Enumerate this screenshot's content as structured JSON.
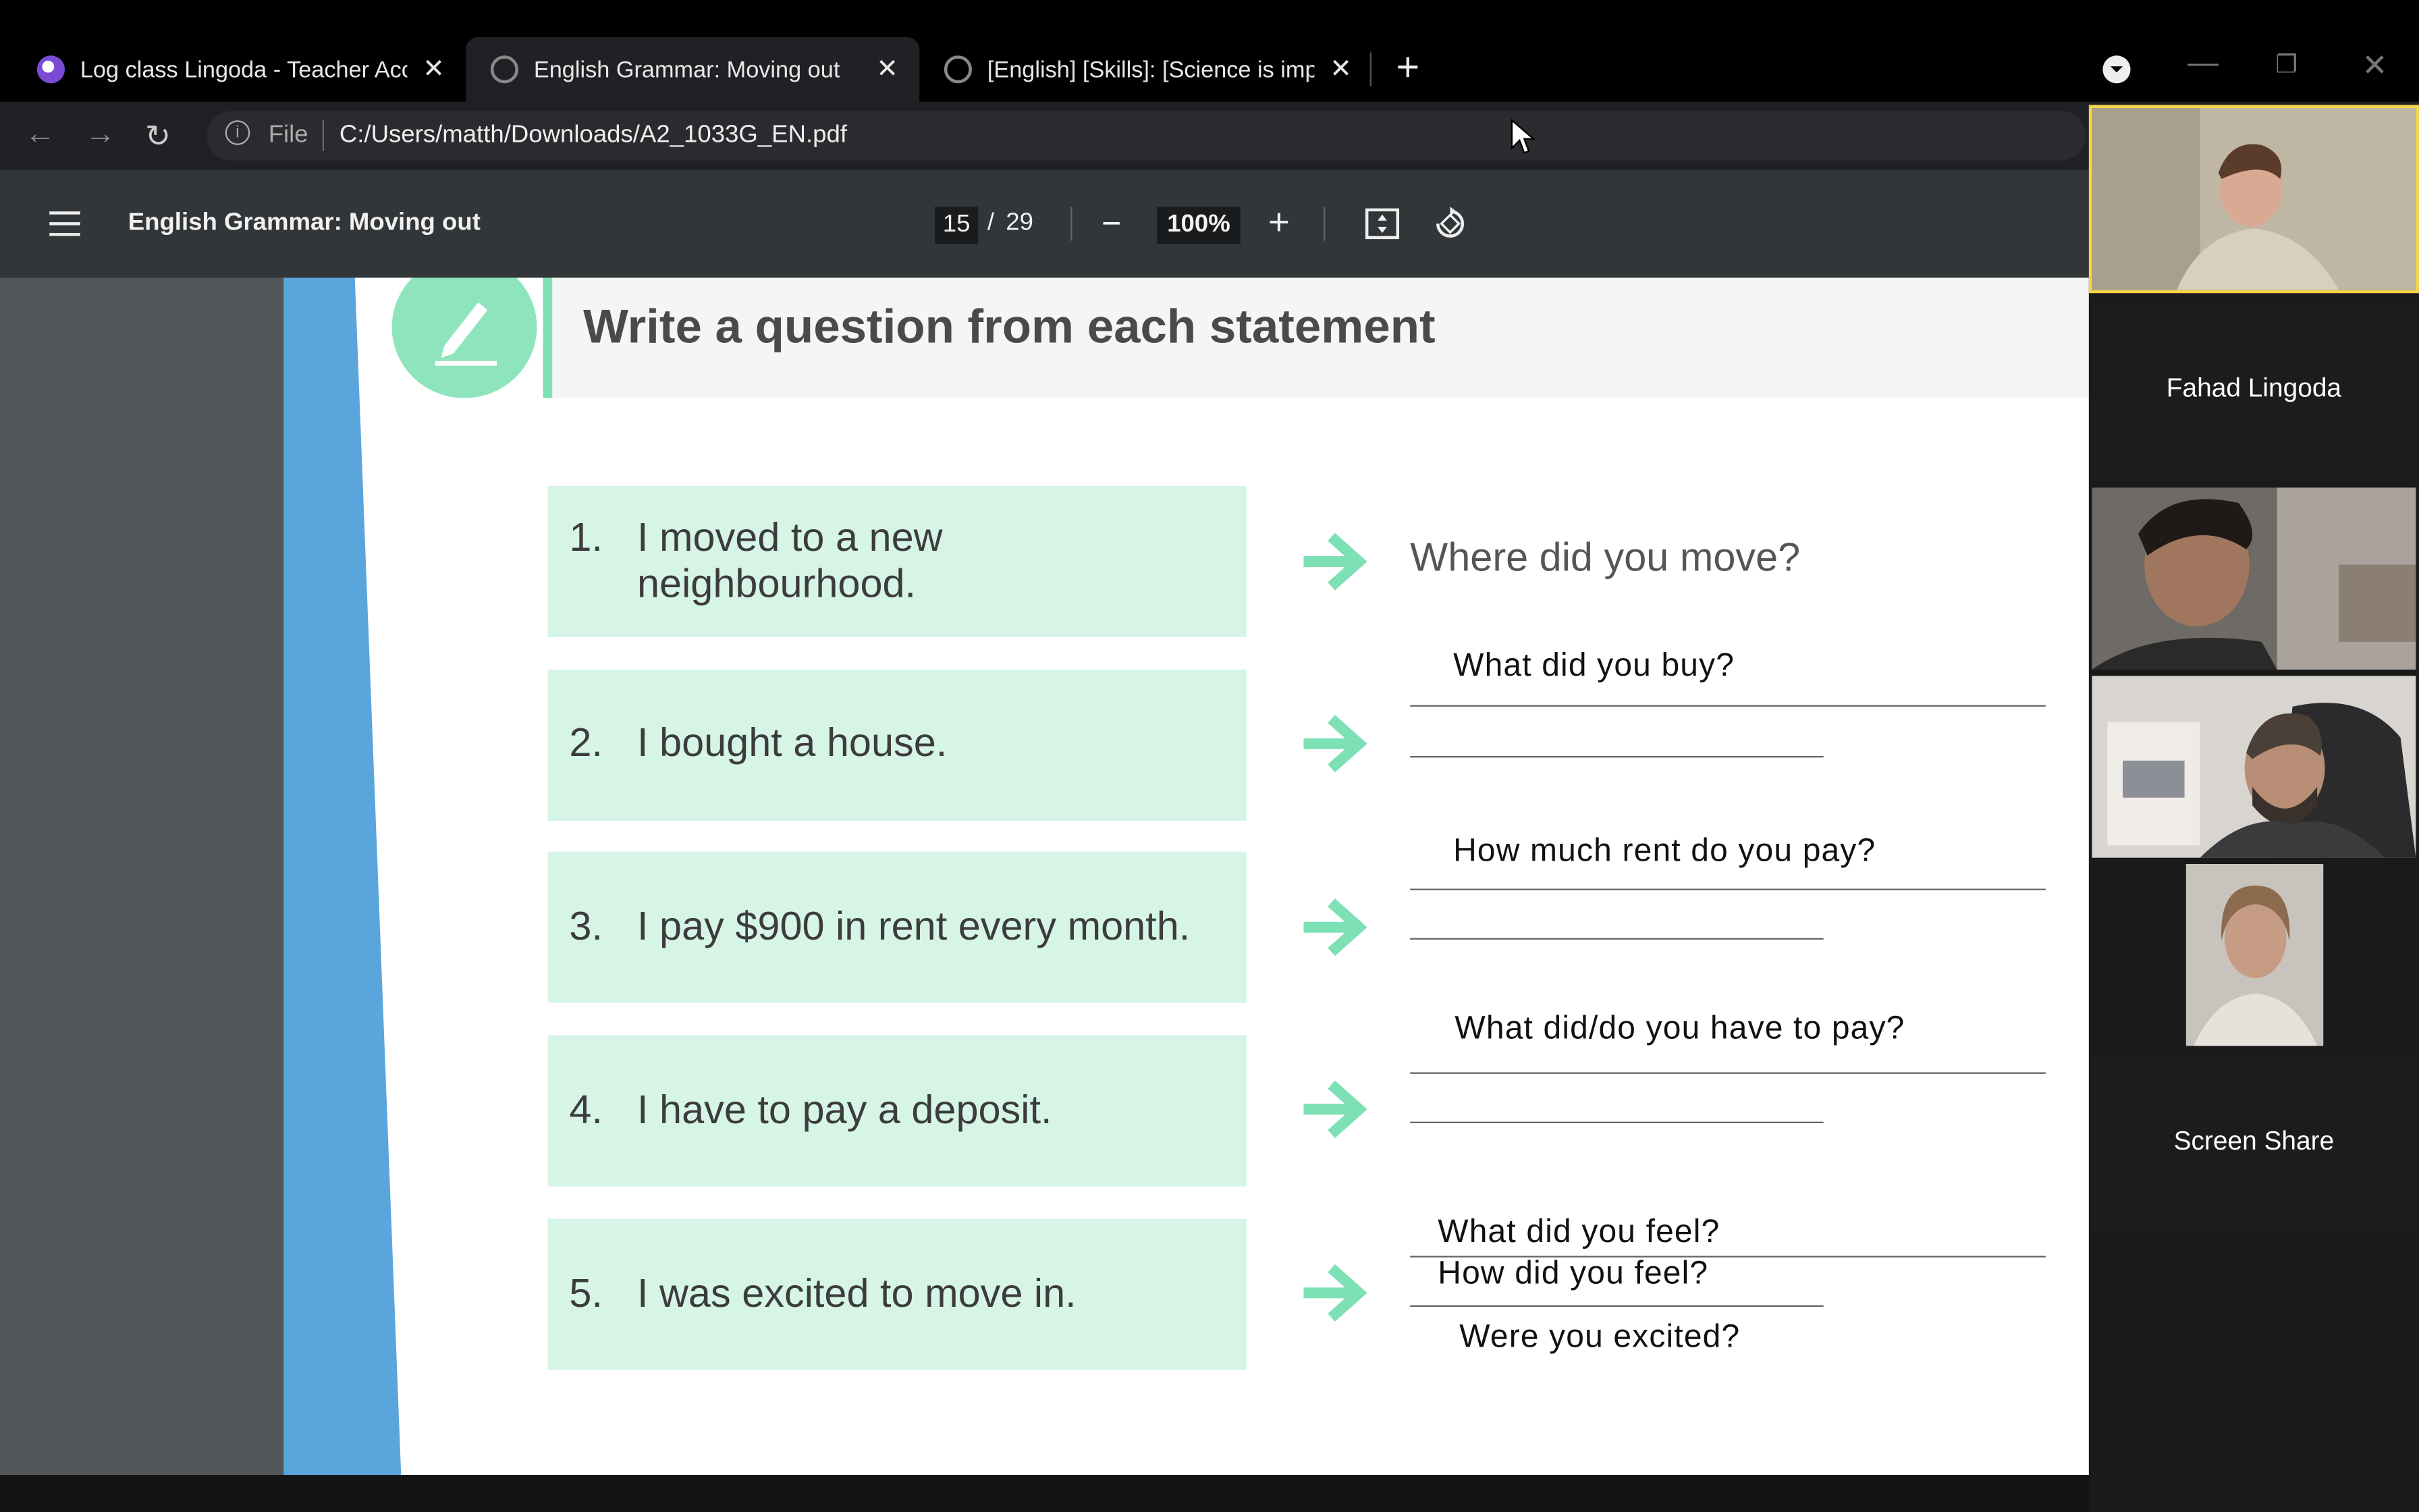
{
  "browser": {
    "tabs": [
      {
        "title": "Log class Lingoda - Teacher Acco",
        "active": false
      },
      {
        "title": "English Grammar: Moving out",
        "active": true
      },
      {
        "title": "[English] [Skills]: [Science is impro",
        "active": false
      }
    ],
    "new_tab_label": "+",
    "address": {
      "scheme_label": "File",
      "url": "C:/Users/matth/Downloads/A2_1033G_EN.pdf"
    }
  },
  "pdf_toolbar": {
    "title": "English Grammar: Moving out",
    "current_page": "15",
    "page_separator": "/",
    "total_pages": "29",
    "zoom": "100%"
  },
  "worksheet": {
    "heading": "Write a question from each statement",
    "items": [
      {
        "num": "1.",
        "statement": "I moved to a new neighbourhood.",
        "answer": "Where did you move?"
      },
      {
        "num": "2.",
        "statement": "I bought a house.",
        "answer": "What did you buy?"
      },
      {
        "num": "3.",
        "statement": "I pay $900 in rent every month.",
        "answer": "How much rent do you pay?"
      },
      {
        "num": "4.",
        "statement": "I have to pay a deposit.",
        "answer": "What did/do you have to pay?"
      },
      {
        "num": "5.",
        "statement": "I was excited to move in.",
        "answers": [
          "What did you feel?",
          "How did you feel?",
          "Were you excited?"
        ]
      }
    ],
    "colors": {
      "accent_green": "#7ee0b5",
      "statement_bg": "#d6f5e7",
      "left_stripe": "#5aa5dc"
    }
  },
  "participants": [
    {
      "name": "",
      "video": true,
      "highlight": true
    },
    {
      "name": "Fahad Lingoda",
      "video": false
    },
    {
      "name": "",
      "video": true
    },
    {
      "name": "",
      "video": true
    },
    {
      "name": "",
      "video": true
    },
    {
      "name": "Screen Share",
      "video": false
    }
  ]
}
